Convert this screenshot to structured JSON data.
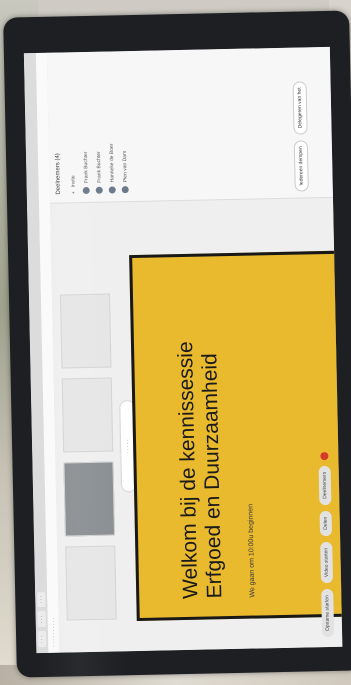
{
  "slide": {
    "title_line1": "Welkom bij de kennissessie",
    "title_line2": "Erfgoed en Duurzaamheid",
    "subtitle": "We gaan om 10:00u beginnen"
  },
  "panel": {
    "header": "Deelnemers (4)",
    "invite": "Invite",
    "participants": [
      {
        "name": "Frank Buchter"
      },
      {
        "name": "Frank Buchter"
      },
      {
        "name": "Hanneke de Boer"
      },
      {
        "name": "Pien van Dam"
      }
    ],
    "button_left": "Iedereen dempen",
    "button_right": "Delegeren van het"
  },
  "toolbar": {
    "recording": "Opname starten",
    "video": "Video starten",
    "share": "Delen",
    "participants": "Deelnemers"
  },
  "colors": {
    "slide_bg": "#e9b92e",
    "stop": "#d63a2f"
  }
}
